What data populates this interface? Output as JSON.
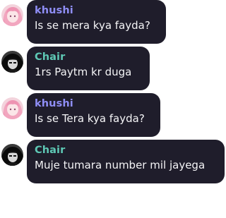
{
  "colors": {
    "bubble": "#1f1d2b",
    "text": "#f4f4f6",
    "name_khushi": "#8f8ef5",
    "name_chair": "#5ec8b5",
    "background": "#ffffff"
  },
  "messages": [
    {
      "author": "khushi",
      "text": "Is se mera kya fayda?",
      "avatar": "anime-girl-avatar-icon"
    },
    {
      "author": "Chair",
      "text": "1rs Paytm kr duga",
      "avatar": "dark-hooded-avatar-icon"
    },
    {
      "author": "khushi",
      "text": "Is se Tera kya fayda?",
      "avatar": "anime-girl-avatar-icon"
    },
    {
      "author": "Chair",
      "text": "Muje tumara number mil jayega",
      "avatar": "dark-hooded-avatar-icon"
    }
  ]
}
